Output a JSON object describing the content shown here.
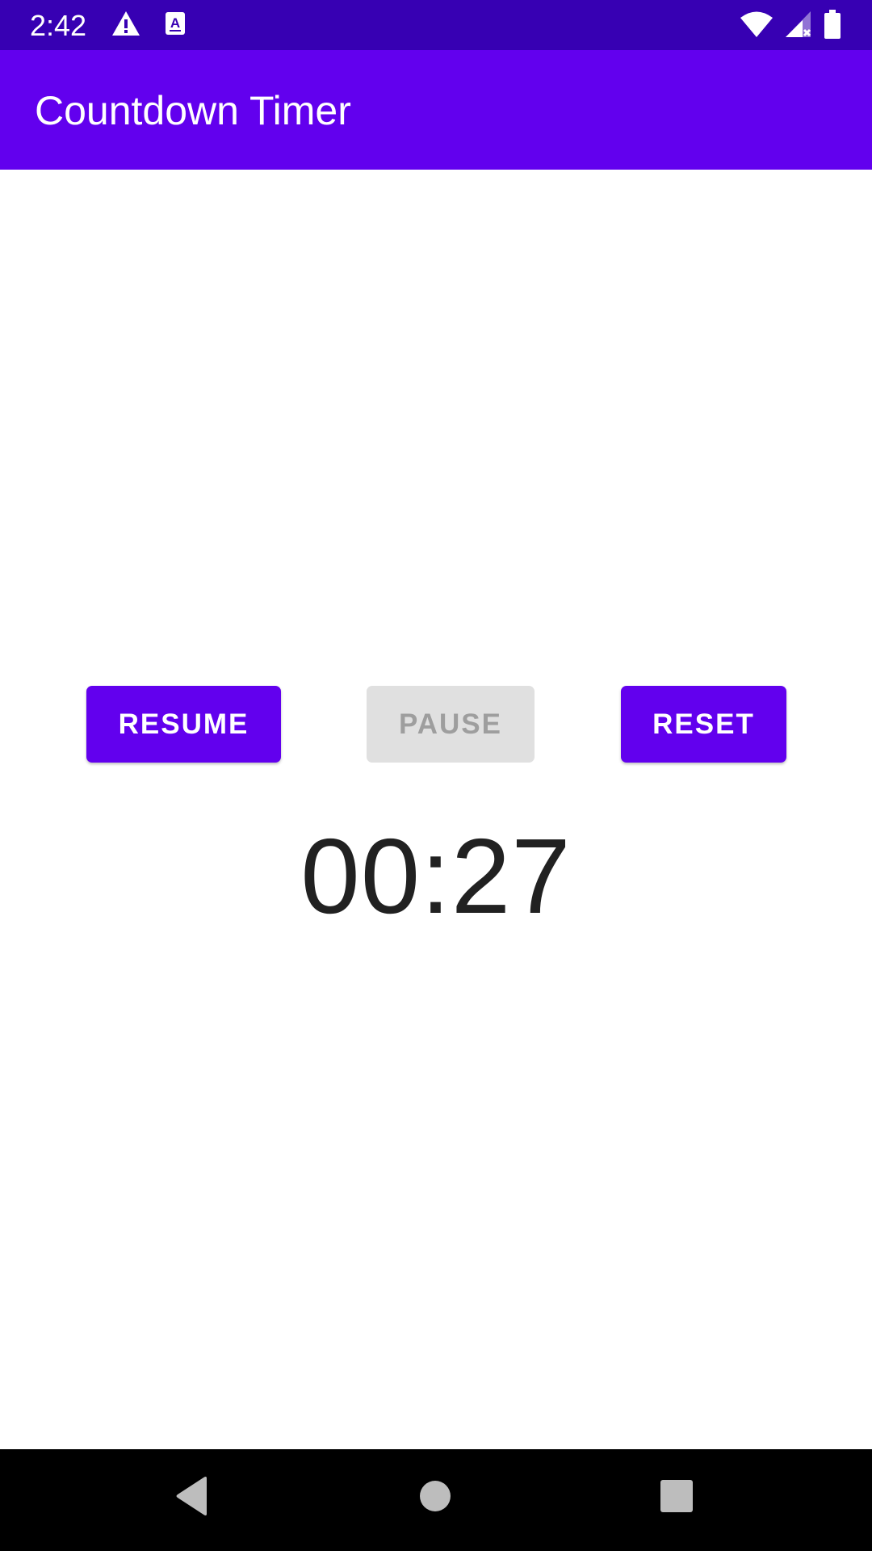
{
  "status_bar": {
    "time": "2:42",
    "icons": [
      "warning-icon",
      "text-a-icon",
      "wifi-icon",
      "signal-icon",
      "battery-icon"
    ]
  },
  "app_bar": {
    "title": "Countdown Timer"
  },
  "controls": {
    "resume_label": "RESUME",
    "pause_label": "PAUSE",
    "reset_label": "RESET"
  },
  "timer": {
    "display": "00:27"
  },
  "nav_bar": {
    "icons": [
      "back-icon",
      "home-icon",
      "recents-icon"
    ]
  },
  "colors": {
    "status_bar": "#3700b3",
    "primary": "#6200ee",
    "disabled_button": "#e0e0e0",
    "disabled_text": "#9e9e9e",
    "timer_text": "#212121"
  }
}
